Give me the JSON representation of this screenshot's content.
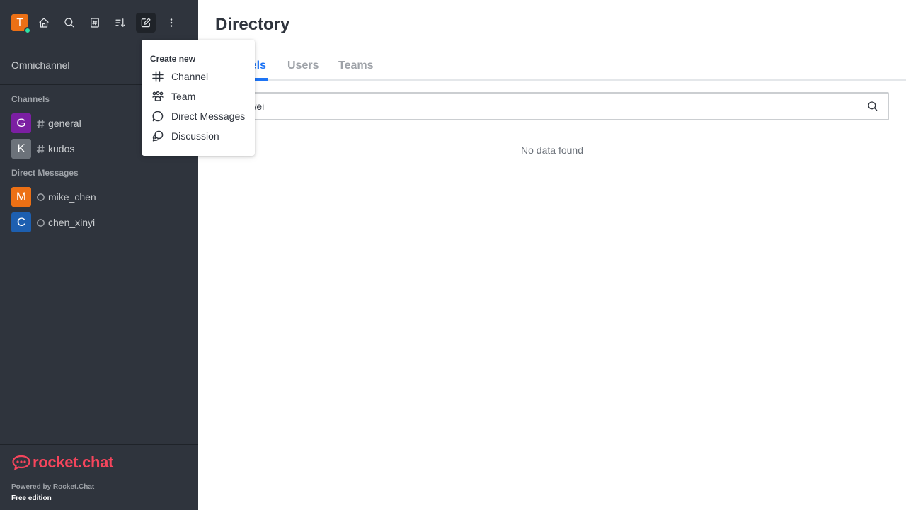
{
  "user": {
    "initial": "T",
    "color": "#ec7015",
    "status_color": "#2de0a5"
  },
  "topbar": {
    "icons": [
      "home-icon",
      "search-icon",
      "directory-icon",
      "sort-icon",
      "create-new-icon",
      "kebab-menu-icon"
    ]
  },
  "sidebar": {
    "omnichannel_label": "Omnichannel",
    "channels_title": "Channels",
    "channels": [
      {
        "initial": "G",
        "name": "general",
        "color": "#7b1fa2"
      },
      {
        "initial": "K",
        "name": "kudos",
        "color": "#6c727a"
      }
    ],
    "dm_title": "Direct Messages",
    "dms": [
      {
        "initial": "M",
        "name": "mike_chen",
        "color": "#ec7015"
      },
      {
        "initial": "C",
        "name": "chen_xinyi",
        "color": "#1d5fb0"
      }
    ]
  },
  "footer": {
    "logo_text": "rocket.chat",
    "powered_by": "Powered by Rocket.Chat",
    "edition": "Free edition",
    "brand_color": "#f5455c"
  },
  "main": {
    "title": "Directory",
    "tabs": [
      {
        "label": "Channels",
        "active": true
      },
      {
        "label": "Users",
        "active": false
      },
      {
        "label": "Teams",
        "active": false
      }
    ],
    "search_value": "chen wei",
    "empty_text": "No data found",
    "accent_color": "#1d74f5"
  },
  "create_menu": {
    "title": "Create new",
    "items": [
      {
        "label": "Channel",
        "icon": "hash-icon"
      },
      {
        "label": "Team",
        "icon": "team-icon"
      },
      {
        "label": "Direct Messages",
        "icon": "chat-bubble-icon"
      },
      {
        "label": "Discussion",
        "icon": "discussion-icon"
      }
    ]
  }
}
